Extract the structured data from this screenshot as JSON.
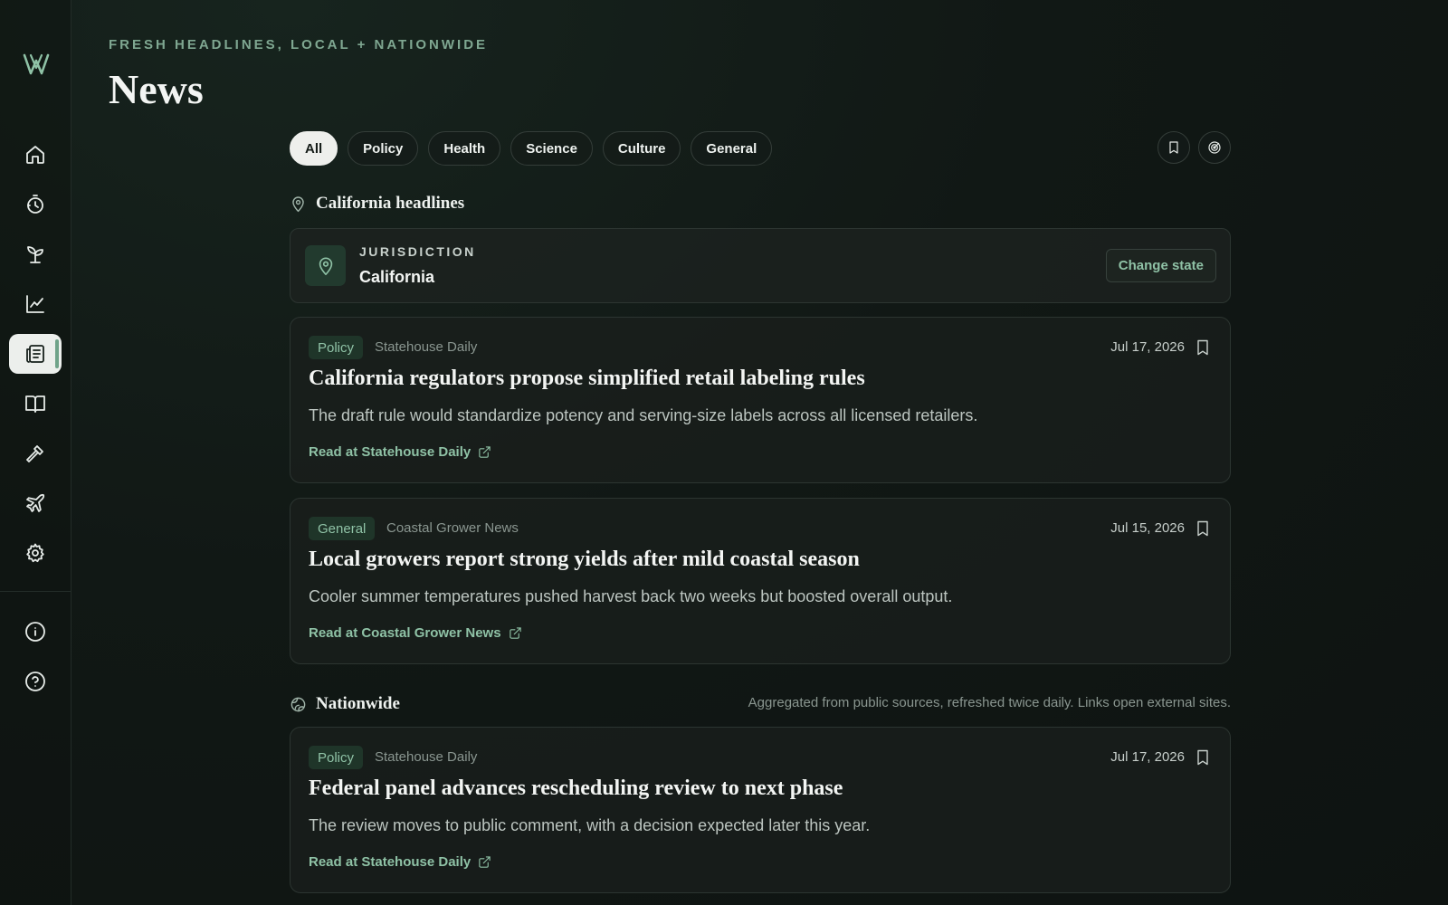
{
  "header": {
    "eyebrow": "FRESH HEADLINES, LOCAL + NATIONWIDE",
    "title": "News"
  },
  "sidebar": {
    "logo": "W",
    "items": [
      {
        "icon": "home-icon",
        "active": false
      },
      {
        "icon": "timer-icon",
        "active": false
      },
      {
        "icon": "sprout-icon",
        "active": false
      },
      {
        "icon": "chart-line-icon",
        "active": false
      },
      {
        "icon": "newspaper-icon",
        "active": true
      },
      {
        "icon": "book-open-icon",
        "active": false
      },
      {
        "icon": "hammer-icon",
        "active": false
      },
      {
        "icon": "plane-icon",
        "active": false
      },
      {
        "icon": "gear-icon",
        "active": false
      },
      {
        "icon": "info-icon",
        "active": false
      },
      {
        "icon": "help-icon",
        "active": false
      }
    ]
  },
  "filters": {
    "chips": [
      "All",
      "Policy",
      "Health",
      "Science",
      "Culture",
      "General"
    ],
    "selected": "All"
  },
  "local": {
    "title": "California headlines",
    "jurisdiction_label": "JURISDICTION",
    "jurisdiction_value": "California",
    "change_label": "Change state",
    "articles": [
      {
        "tag": "Policy",
        "source": "Statehouse Daily",
        "date": "Jul 17, 2026",
        "headline": "California regulators propose simplified retail labeling rules",
        "summary": "The draft rule would standardize potency and serving-size labels across all licensed retailers.",
        "link": "Read at Statehouse Daily"
      },
      {
        "tag": "General",
        "source": "Coastal Grower News",
        "date": "Jul 15, 2026",
        "headline": "Local growers report strong yields after mild coastal season",
        "summary": "Cooler summer temperatures pushed harvest back two weeks but boosted overall output.",
        "link": "Read at Coastal Grower News"
      }
    ]
  },
  "nationwide": {
    "title": "Nationwide",
    "note": "Aggregated from public sources, refreshed twice daily. Links open external sites.",
    "articles": [
      {
        "tag": "Policy",
        "source": "Statehouse Daily",
        "date": "Jul 17, 2026",
        "headline": "Federal panel advances rescheduling review to next phase",
        "summary": "The review moves to public comment, with a decision expected later this year.",
        "link": "Read at Statehouse Daily"
      }
    ]
  },
  "colors": {
    "accent": "#8fc2a6",
    "background": "#111815",
    "active_nav": "#ecefec"
  }
}
